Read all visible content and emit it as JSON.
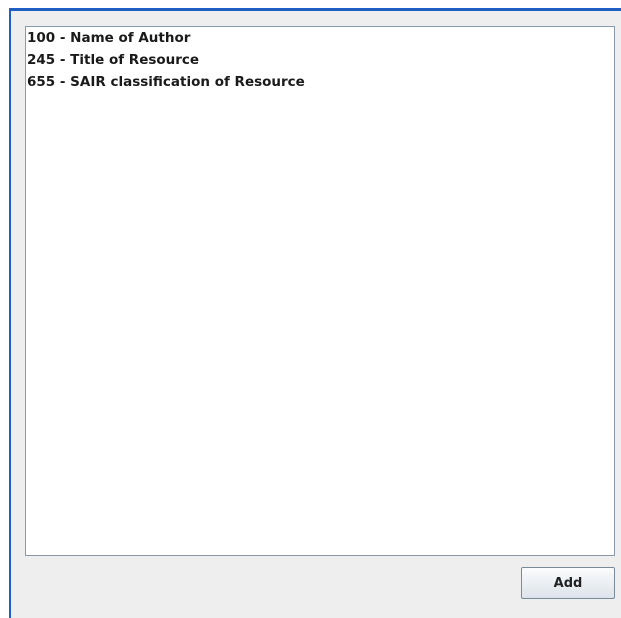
{
  "list": {
    "items": [
      "100 - Name of Author",
      "245 - Title of Resource",
      "655 - SAIR classification of Resource"
    ]
  },
  "actions": {
    "add_label": "Add"
  },
  "colors": {
    "accent": "#1f5fc4",
    "panel_background": "#eeeeee",
    "list_background": "#ffffff"
  }
}
